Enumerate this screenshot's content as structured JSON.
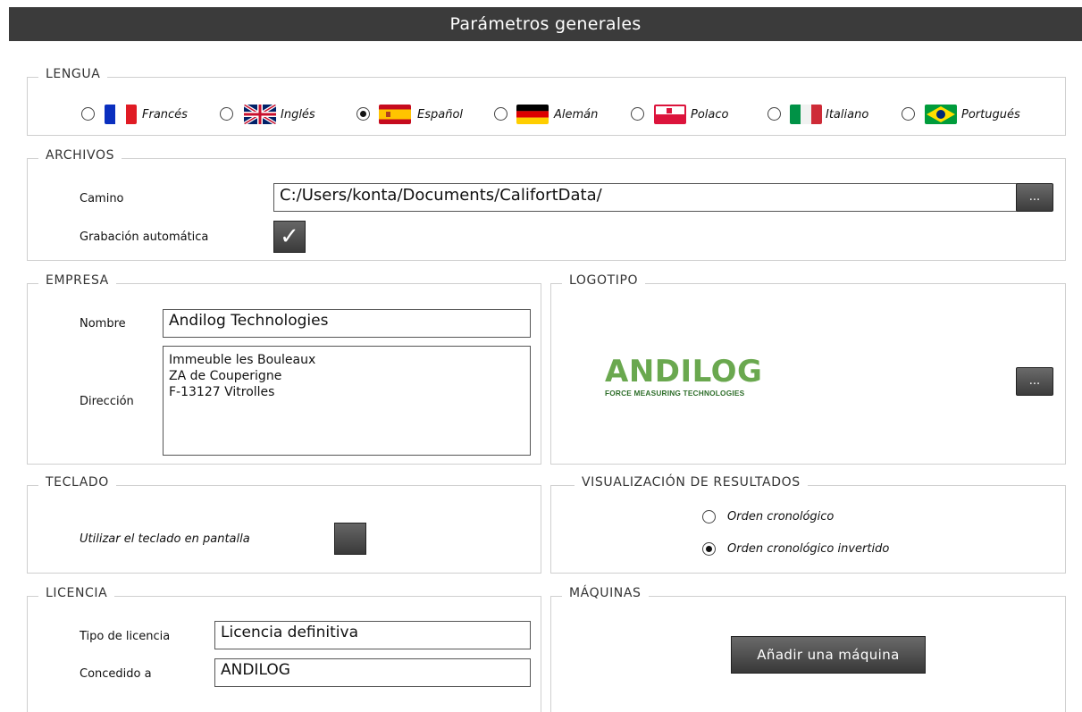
{
  "window": {
    "title": "Parámetros generales"
  },
  "language": {
    "legend": "LENGUA",
    "selected": "Español",
    "options": [
      {
        "label": "Francés",
        "flag": "flag-france-icon",
        "selected": false
      },
      {
        "label": "Inglés",
        "flag": "flag-uk-icon",
        "selected": false
      },
      {
        "label": "Español",
        "flag": "flag-spain-icon",
        "selected": true
      },
      {
        "label": "Alemán",
        "flag": "flag-germany-icon",
        "selected": false
      },
      {
        "label": "Polaco",
        "flag": "flag-poland-icon",
        "selected": false
      },
      {
        "label": "Italiano",
        "flag": "flag-italy-icon",
        "selected": false
      },
      {
        "label": "Portugués",
        "flag": "flag-brazil-icon",
        "selected": false
      }
    ]
  },
  "files": {
    "legend": "ARCHIVOS",
    "path_label": "Camino",
    "path_value": "C:/Users/konta/Documents/CalifortData/",
    "browse_label": "...",
    "autosave_label": "Grabación automática",
    "autosave_checked": true,
    "check_glyph": "✓"
  },
  "company": {
    "legend": "EMPRESA",
    "name_label": "Nombre",
    "name_value": "Andilog Technologies",
    "address_label": "Dirección",
    "address_lines": [
      "Immeuble les Bouleaux",
      "ZA de Couperigne",
      "F-13127 Vitrolles"
    ]
  },
  "logo": {
    "legend": "LOGOTIPO",
    "brand_text": "ANDILOG",
    "brand_tagline": "FORCE MEASURING TECHNOLOGIES",
    "brand_color": "#6aa84f",
    "browse_label": "..."
  },
  "keyboard": {
    "legend": "TECLADO",
    "onscreen_label": "Utilizar el teclado en pantalla",
    "onscreen_checked": false
  },
  "results": {
    "legend": "VISUALIZACIÓN DE RESULTADOS",
    "options": [
      {
        "label": "Orden cronológico",
        "selected": false
      },
      {
        "label": "Orden cronológico invertido",
        "selected": true
      }
    ]
  },
  "license": {
    "legend": "LICENCIA",
    "type_label": "Tipo de licencia",
    "type_value": "Licencia definitiva",
    "granted_label": "Concedido a",
    "granted_value": "ANDILOG"
  },
  "machines": {
    "legend": "MÁQUINAS",
    "add_label": "Añadir una máquina"
  }
}
